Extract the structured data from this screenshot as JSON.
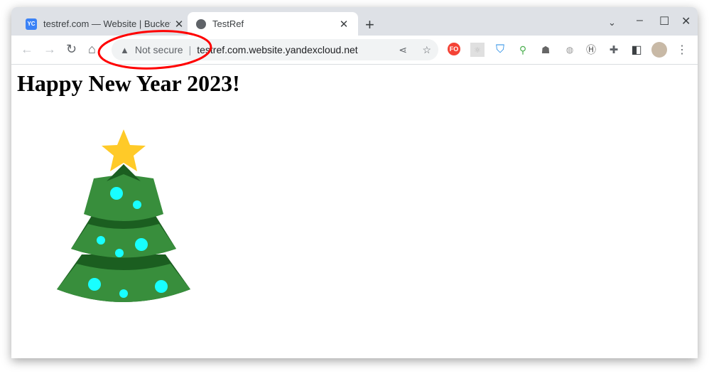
{
  "tabs": [
    {
      "label": "testref.com — Website | Bucket",
      "icon": "yc-favicon",
      "icon_text": "YC",
      "active": false
    },
    {
      "label": "TestRef",
      "icon": "globe-icon",
      "active": true
    }
  ],
  "address": {
    "security": "Not secure",
    "url": "testref.com.website.yandexcloud.net"
  },
  "extensions": {
    "fo_text": "FO"
  },
  "page": {
    "heading": "Happy New Year 2023!"
  },
  "colors": {
    "tree": "#388e3c",
    "tree_dark": "#1b5e20",
    "star": "#ffca28",
    "ornament": "#18ffff",
    "annotation": "#ff0000"
  }
}
